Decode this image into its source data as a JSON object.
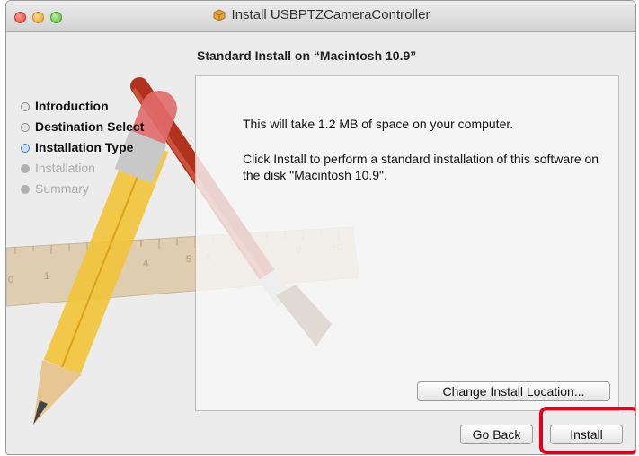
{
  "window": {
    "title": "Install USBPTZCameraController",
    "title_icon": "installer-package-icon"
  },
  "header": {
    "title": "Standard Install on “Macintosh 10.9”"
  },
  "sidebar": {
    "steps": [
      {
        "label": "Introduction",
        "state": "done"
      },
      {
        "label": "Destination Select",
        "state": "done"
      },
      {
        "label": "Installation Type",
        "state": "active"
      },
      {
        "label": "Installation",
        "state": "pending"
      },
      {
        "label": "Summary",
        "state": "pending"
      }
    ]
  },
  "content": {
    "space_message": "This will take 1.2 MB of space on your computer.",
    "install_message": "Click Install to perform a standard installation of this software on the disk \"Macintosh 10.9\".",
    "change_location_label": "Change Install Location..."
  },
  "footer": {
    "back_label": "Go Back",
    "install_label": "Install"
  },
  "annotation": {
    "highlight_color": "#e3001b",
    "highlight_target": "install-button"
  },
  "ruler": {
    "tick_labels": [
      "0",
      "1",
      "4",
      "5",
      "6",
      "9",
      "10"
    ]
  }
}
